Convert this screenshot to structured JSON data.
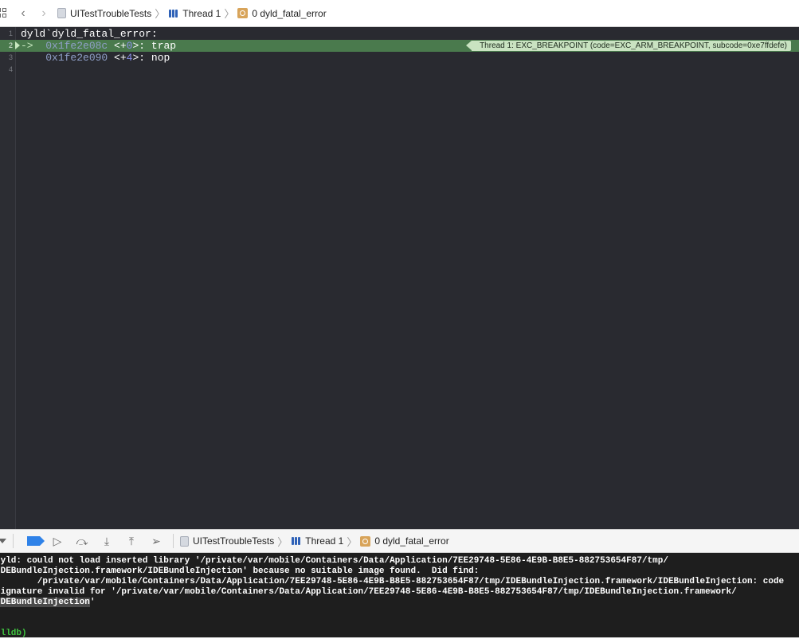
{
  "jumpbar": {
    "crumbs": [
      {
        "label": "UITestTroubleTests",
        "icon": "project-icon"
      },
      {
        "label": "Thread 1",
        "icon": "thread-icon"
      },
      {
        "label": "0 dyld_fatal_error",
        "icon": "stack-frame-icon"
      }
    ]
  },
  "editor": {
    "lines": [
      {
        "number": "1",
        "text": "dyld`dyld_fatal_error:"
      },
      {
        "number": "2",
        "arrow": "->",
        "address": "0x1fe2e08c",
        "offset_open": "<+",
        "offset": "0",
        "offset_close": ">:",
        "instruction": "trap"
      },
      {
        "number": "3",
        "address": "0x1fe2e090",
        "offset_open": "<+",
        "offset": "4",
        "offset_close": ">:",
        "instruction": "nop"
      },
      {
        "number": "4"
      }
    ],
    "exception_badge": "Thread 1: EXC_BREAKPOINT (code=EXC_ARM_BREAKPOINT, subcode=0xe7ffdefe)"
  },
  "debugbar": {
    "crumbs": [
      {
        "label": "UITestTroubleTests"
      },
      {
        "label": "Thread 1"
      },
      {
        "label": "0 dyld_fatal_error"
      }
    ]
  },
  "console": {
    "lines": [
      "dyld: could not load inserted library '/private/var/mobile/Containers/Data/Application/7EE29748-5E86-4E9B-B8E5-882753654F87/tmp/",
      "IDEBundleInjection.framework/IDEBundleInjection' because no suitable image found.  Did find:",
      "        /private/var/mobile/Containers/Data/Application/7EE29748-5E86-4E9B-B8E5-882753654F87/tmp/IDEBundleInjection.framework/IDEBundleInjection: code",
      "signature invalid for '/private/var/mobile/Containers/Data/Application/7EE29748-5E86-4E9B-B8E5-882753654F87/tmp/IDEBundleInjection.framework/"
    ],
    "selected_text": "IDEBundleInjection",
    "trailing_text": "'",
    "prompt": "(lldb)"
  },
  "colors": {
    "editor_bg": "#292a30",
    "pc_line": "#4a7a4d",
    "exception_badge": "#c9e3c1",
    "breakpoint_button": "#2f82e8",
    "lldb_prompt": "#3fc43f"
  }
}
